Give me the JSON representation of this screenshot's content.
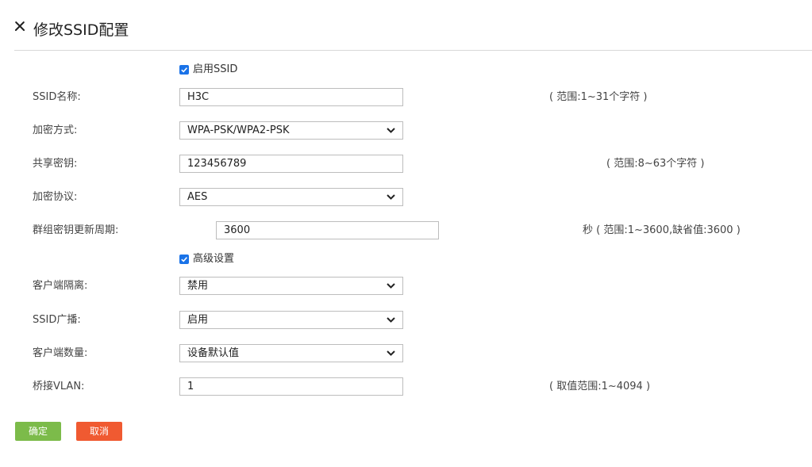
{
  "header": {
    "title": "修改SSID配置"
  },
  "enable_ssid": {
    "label": "启用SSID",
    "checked": true
  },
  "ssid_name": {
    "label": "SSID名称:",
    "value": "H3C",
    "hint": "( 范围:1~31个字符 )"
  },
  "encryption_mode": {
    "label": "加密方式:",
    "value": "WPA-PSK/WPA2-PSK"
  },
  "shared_key": {
    "label": "共享密钥:",
    "value": "123456789",
    "hint": "( 范围:8~63个字符 )"
  },
  "encryption_protocol": {
    "label": "加密协议:",
    "value": "AES"
  },
  "group_key_period": {
    "label": "群组密钥更新周期:",
    "value": "3600",
    "hint": "秒 ( 范围:1~3600,缺省值:3600 )"
  },
  "advanced": {
    "label": "高级设置",
    "checked": true
  },
  "client_isolation": {
    "label": "客户端隔离:",
    "value": "禁用"
  },
  "ssid_broadcast": {
    "label": "SSID广播:",
    "value": "启用"
  },
  "client_count": {
    "label": "客户端数量:",
    "value": "设备默认值"
  },
  "bridge_vlan": {
    "label": "桥接VLAN:",
    "value": "1",
    "hint": "( 取值范围:1~4094 )"
  },
  "buttons": {
    "confirm": "确定",
    "cancel": "取消"
  },
  "colors": {
    "checkbox": "#1a73e8",
    "confirm_button": "#7cbb4a",
    "cancel_button": "#f05a31",
    "border": "#bdbdbd"
  },
  "icons": {
    "close": "close-icon",
    "dropdown": "chevron-down-icon",
    "checkbox": "checkmark-icon"
  }
}
